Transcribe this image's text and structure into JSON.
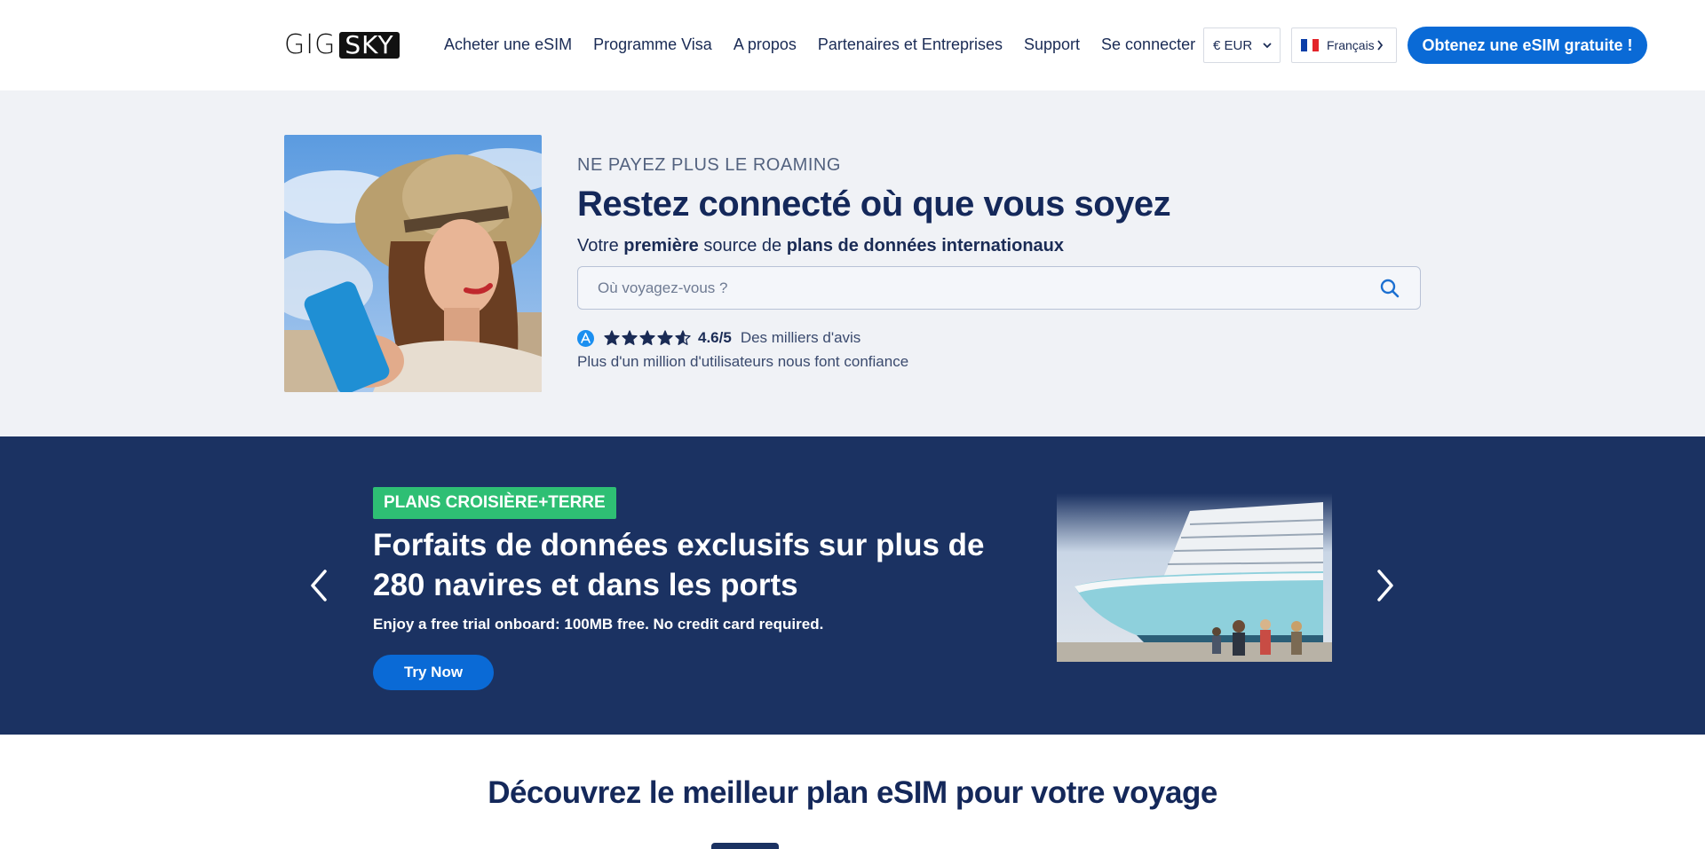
{
  "header": {
    "logo_alt": "GigSky",
    "nav": [
      {
        "label": "Acheter une eSIM"
      },
      {
        "label": "Programme Visa"
      },
      {
        "label": "A propos"
      },
      {
        "label": "Partenaires et Entreprises"
      },
      {
        "label": "Support"
      },
      {
        "label": "Se connecter"
      }
    ],
    "currency": "€ EUR",
    "language": "Français",
    "cta_label": "Obtenez une eSIM gratuite !"
  },
  "hero": {
    "eyebrow": "NE PAYEZ PLUS LE ROAMING",
    "title": "Restez connecté où que vous soyez",
    "subtitle_parts": [
      "Votre ",
      "première",
      " source de ",
      "plans de données internationaux"
    ],
    "search_placeholder": "Où voyagez-vous ?",
    "rating_score": "4.6/5",
    "rating_value": 4.6,
    "rating_max": 5,
    "rating_text": "Des milliers d'avis",
    "trust_text": "Plus d'un million d'utilisateurs nous font confiance"
  },
  "banner": {
    "badge": "PLANS CROISIÈRE+TERRE",
    "title": "Forfaits de données exclusifs sur plus de 280 navires et dans les ports",
    "subtitle": "Enjoy a free trial onboard: 100MB free. No credit card required.",
    "button_label": "Try Now"
  },
  "section": {
    "title": "Découvrez le meilleur plan eSIM pour votre voyage"
  },
  "colors": {
    "primary": "#0a6ad6",
    "navy": "#1b3262",
    "badge_green": "#2ebf74",
    "hero_bg": "#f0f2f6"
  }
}
